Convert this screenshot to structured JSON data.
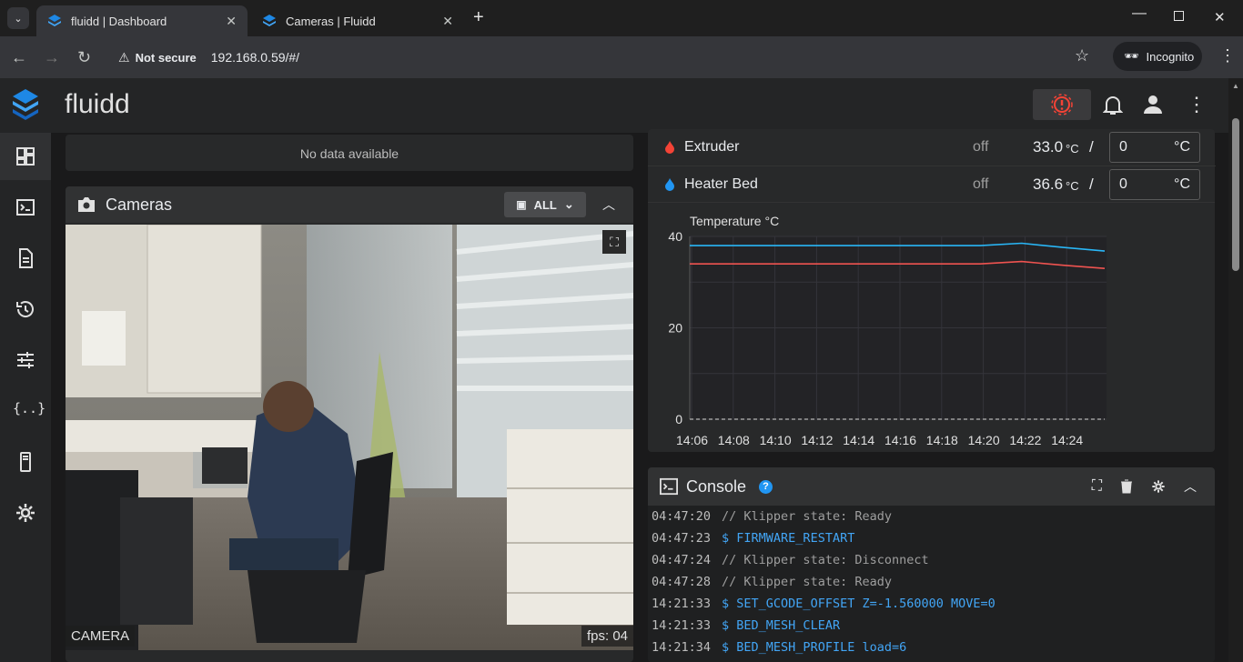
{
  "browser": {
    "tabs": [
      {
        "title": "fluidd | Dashboard",
        "active": true
      },
      {
        "title": "Cameras | Fluidd",
        "active": false
      }
    ],
    "security_label": "Not secure",
    "url": "192.168.0.59/#/",
    "profile_label": "Incognito"
  },
  "app": {
    "title": "fluidd",
    "colors": {
      "brand": "#1e88e5",
      "danger": "#f44336",
      "accent": "#2196f3"
    }
  },
  "sidebar": {
    "items": [
      {
        "icon": "dashboard-icon"
      },
      {
        "icon": "console-icon"
      },
      {
        "icon": "jobs-file-icon"
      },
      {
        "icon": "history-icon"
      },
      {
        "icon": "tune-icon"
      },
      {
        "icon": "config-braces-icon"
      },
      {
        "icon": "system-icon"
      },
      {
        "icon": "settings-gear-icon"
      }
    ]
  },
  "jobs_card": {
    "empty_text": "No data available"
  },
  "cameras": {
    "title": "Cameras",
    "filter_label": "ALL",
    "camera_name": "CAMERA",
    "fps_label": "fps: 04"
  },
  "heaters": [
    {
      "name": "Extruder",
      "state": "off",
      "current": "33.0",
      "unit": "°C",
      "target": "0",
      "target_unit": "°C",
      "color": "#f44336"
    },
    {
      "name": "Heater Bed",
      "state": "off",
      "current": "36.6",
      "unit": "°C",
      "target": "0",
      "target_unit": "°C",
      "color": "#2196f3"
    }
  ],
  "chart_data": {
    "type": "line",
    "title": "",
    "ylabel": "Temperature °C",
    "xlabel": "",
    "ylim": [
      0,
      40
    ],
    "yticks": [
      0,
      20,
      40
    ],
    "x": [
      "14:06",
      "14:08",
      "14:10",
      "14:12",
      "14:14",
      "14:16",
      "14:18",
      "14:20",
      "14:22",
      "14:24"
    ],
    "series": [
      {
        "color": "#29b6f6",
        "values": [
          38.0,
          38.0,
          38.0,
          38.0,
          38.0,
          38.0,
          38.0,
          38.0,
          38.5,
          37.6,
          36.8
        ]
      },
      {
        "color": "#ef5350",
        "values": [
          34.0,
          34.0,
          34.0,
          34.0,
          34.0,
          34.0,
          34.0,
          34.0,
          34.5,
          33.7,
          33.0
        ]
      },
      {
        "color": "#9e9e9e",
        "values": [
          0,
          0,
          0,
          0,
          0,
          0,
          0,
          0,
          0,
          0,
          0
        ]
      }
    ],
    "grid": true
  },
  "console": {
    "title": "Console",
    "lines": [
      {
        "time": "04:47:20",
        "text": "// Klipper state: Ready",
        "kind": "msg"
      },
      {
        "time": "04:47:23",
        "text": "$ FIRMWARE_RESTART",
        "kind": "cmd"
      },
      {
        "time": "04:47:24",
        "text": "// Klipper state: Disconnect",
        "kind": "msg"
      },
      {
        "time": "04:47:28",
        "text": "// Klipper state: Ready",
        "kind": "msg"
      },
      {
        "time": "14:21:33",
        "text": "$ SET_GCODE_OFFSET Z=-1.560000 MOVE=0",
        "kind": "cmd"
      },
      {
        "time": "14:21:33",
        "text": "$ BED_MESH_CLEAR",
        "kind": "cmd"
      },
      {
        "time": "14:21:34",
        "text": "$ BED_MESH_PROFILE load=6",
        "kind": "cmd"
      }
    ]
  }
}
